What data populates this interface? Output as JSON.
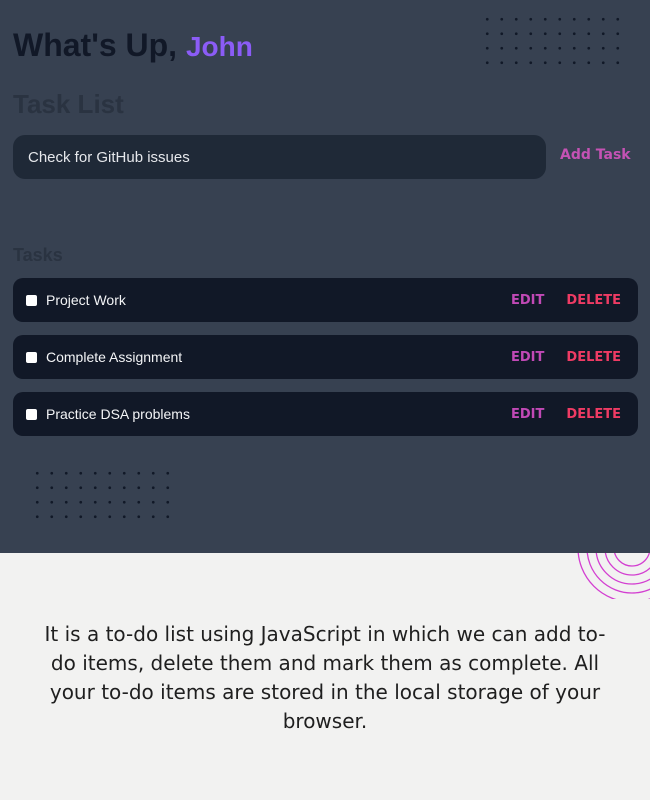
{
  "header": {
    "greeting": "What's Up,",
    "user_name": "John"
  },
  "task_section": {
    "title": "Task List",
    "input_value": "Check for GitHub issues",
    "add_button_label": "Add Task"
  },
  "tasks": {
    "heading": "Tasks",
    "items": [
      {
        "label": "Project Work",
        "completed": false,
        "edit_label": "EDIT",
        "delete_label": "DELETE"
      },
      {
        "label": "Complete Assignment",
        "completed": false,
        "edit_label": "EDIT",
        "delete_label": "DELETE"
      },
      {
        "label": "Practice DSA problems",
        "completed": false,
        "edit_label": "EDIT",
        "delete_label": "DELETE"
      }
    ]
  },
  "caption": {
    "text": "It is a to-do list using JavaScript in which we can add to-do items, delete them and mark them as complete. All your to-do items are stored in the local storage of your browser."
  },
  "colors": {
    "app_background": "#374151",
    "input_background": "#1f2937",
    "task_background": "#111827",
    "accent_name": "#8b5cf6",
    "edit": "#c149b6",
    "delete": "#ef3b64",
    "page_background": "#f2f2f1"
  }
}
